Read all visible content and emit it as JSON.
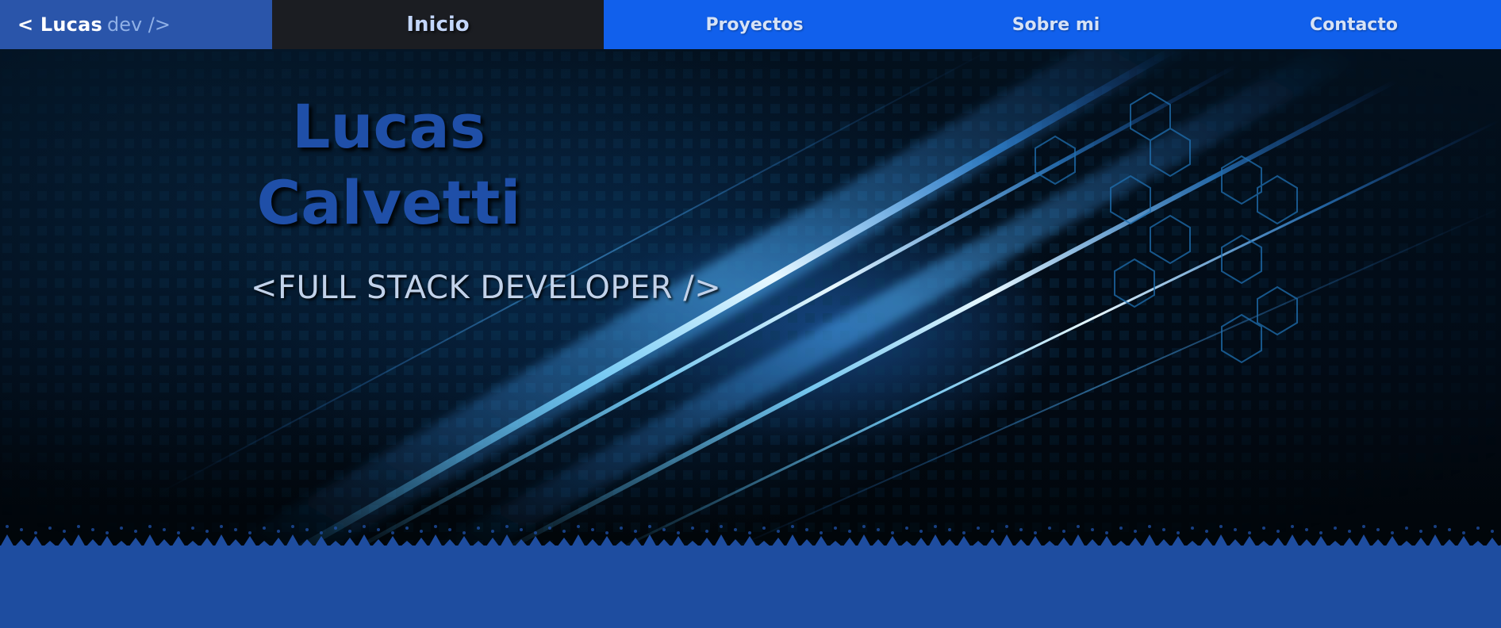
{
  "nav": {
    "brand": {
      "name": "< Lucas",
      "suffix": "dev />"
    },
    "items": [
      {
        "label": "Inicio",
        "active": true
      },
      {
        "label": "Proyectos",
        "active": false
      },
      {
        "label": "Sobre mi",
        "active": false
      },
      {
        "label": "Contacto",
        "active": false
      }
    ]
  },
  "hero": {
    "name_line1": "Lucas",
    "name_line2": "Calvetti",
    "role": "<FULL STACK DEVELOPER />"
  },
  "colors": {
    "nav_bar": "#1160ec",
    "brand_bg": "#2a55aa",
    "active_tab_bg": "#1b1d22",
    "hero_name": "#1f4fa8",
    "bottom_band": "#1e4da0"
  }
}
